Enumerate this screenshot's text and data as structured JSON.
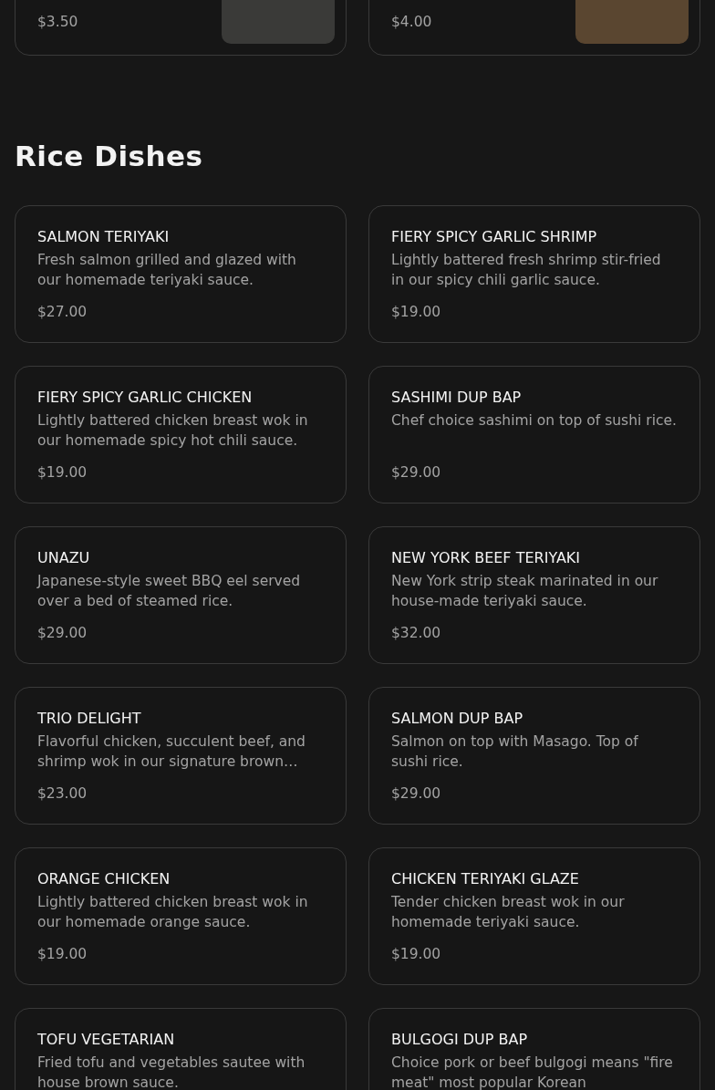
{
  "previous_items": [
    {
      "price": "$3.50"
    },
    {
      "price": "$4.00"
    }
  ],
  "section": {
    "title": "Rice Dishes",
    "items": [
      {
        "name": "SALMON TERIYAKI",
        "description": "Fresh salmon grilled and glazed with our homemade teriyaki sauce.",
        "price": "$27.00"
      },
      {
        "name": "FIERY SPICY GARLIC SHRIMP",
        "description": "Lightly battered fresh shrimp stir-fried in our spicy chili garlic sauce.",
        "price": "$19.00"
      },
      {
        "name": "FIERY SPICY GARLIC CHICKEN",
        "description": "Lightly battered chicken breast wok in our homemade spicy hot chili sauce.",
        "price": "$19.00"
      },
      {
        "name": "SASHIMI DUP BAP",
        "description": "Chef choice sashimi on top of sushi rice.",
        "price": "$29.00"
      },
      {
        "name": "UNAZU",
        "description": "Japanese-style sweet BBQ eel served over a bed of steamed rice.",
        "price": "$29.00"
      },
      {
        "name": "NEW YORK BEEF TERIYAKI",
        "description": "New York strip steak marinated in our house-made teriyaki sauce.",
        "price": "$32.00"
      },
      {
        "name": "TRIO DELIGHT",
        "description": "Flavorful chicken, succulent beef, and shrimp wok in our signature brown…",
        "price": "$23.00"
      },
      {
        "name": "SALMON DUP BAP",
        "description": "Salmon on top with Masago. Top of sushi rice.",
        "price": "$29.00"
      },
      {
        "name": "ORANGE CHICKEN",
        "description": "Lightly battered chicken breast wok in our homemade orange sauce.",
        "price": "$19.00"
      },
      {
        "name": "CHICKEN TERIYAKI GLAZE",
        "description": "Tender chicken breast wok in our homemade teriyaki sauce.",
        "price": "$19.00"
      },
      {
        "name": "TOFU VEGETARIAN",
        "description": "Fried tofu and vegetables sautee with house brown sauce."
      },
      {
        "name": "BULGOGI DUP BAP",
        "description": "Choice pork or beef bulgogi means \"fire meat\" most popular Korean"
      }
    ]
  }
}
